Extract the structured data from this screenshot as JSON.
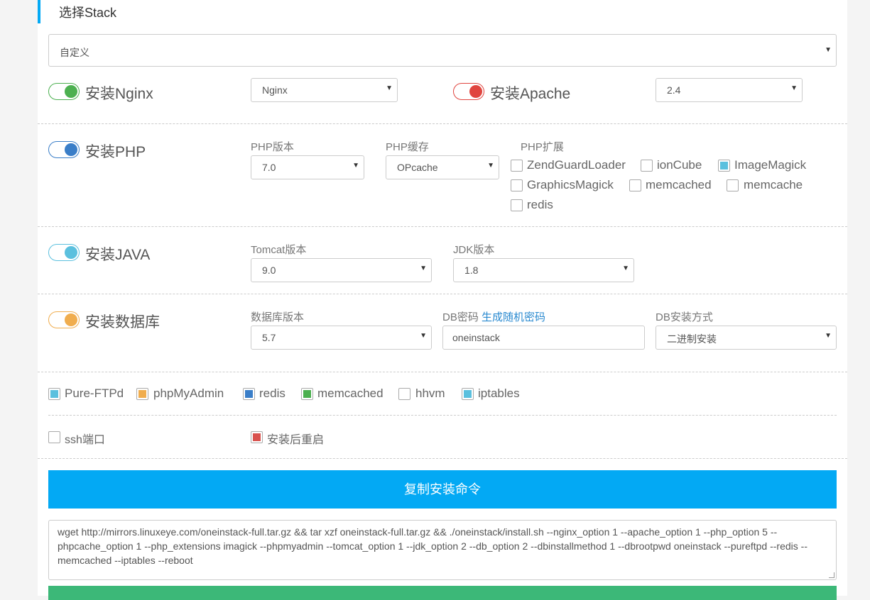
{
  "header": {
    "title": "选择Stack"
  },
  "stack_select": {
    "value": "自定义"
  },
  "nginx": {
    "label": "安装Nginx",
    "version": "Nginx",
    "color": "#4cb050"
  },
  "apache": {
    "label": "安装Apache",
    "version": "2.4",
    "color": "#e0453f"
  },
  "php": {
    "label": "安装PHP",
    "color": "#3a7ec8",
    "version_label": "PHP版本",
    "version": "7.0",
    "cache_label": "PHP缓存",
    "cache": "OPcache",
    "ext_label": "PHP扩展",
    "extensions": [
      {
        "name": "ZendGuardLoader",
        "checked": false
      },
      {
        "name": "ionCube",
        "checked": false
      },
      {
        "name": "ImageMagick",
        "checked": true
      },
      {
        "name": "GraphicsMagick",
        "checked": false
      },
      {
        "name": "memcached",
        "checked": false
      },
      {
        "name": "memcache",
        "checked": false
      },
      {
        "name": "redis",
        "checked": false
      }
    ]
  },
  "java": {
    "label": "安装JAVA",
    "color": "#5bc0de",
    "tomcat_label": "Tomcat版本",
    "tomcat": "9.0",
    "jdk_label": "JDK版本",
    "jdk": "1.8"
  },
  "db": {
    "label": "安装数据库",
    "color": "#f0ad4e",
    "version_label": "数据库版本",
    "version": "5.7",
    "password_label": "DB密码",
    "password_link": "生成随机密码",
    "password": "oneinstack",
    "method_label": "DB安装方式",
    "method": "二进制安装"
  },
  "extras": [
    {
      "name": "Pure-FTPd",
      "checked": true,
      "color": "#5bc0de"
    },
    {
      "name": "phpMyAdmin",
      "checked": true,
      "color": "#f0ad4e"
    },
    {
      "name": "redis",
      "checked": true,
      "color": "#3a7ec8"
    },
    {
      "name": "memcached",
      "checked": true,
      "color": "#4cb050"
    },
    {
      "name": "hhvm",
      "checked": false,
      "color": "#ffffff"
    },
    {
      "name": "iptables",
      "checked": true,
      "color": "#5bc0de"
    }
  ],
  "options": {
    "ssh_port": {
      "label": "ssh端口",
      "checked": false
    },
    "reboot": {
      "label": "安装后重启",
      "checked": true,
      "color": "#d9534f"
    }
  },
  "copy_button": {
    "label": "复制安装命令"
  },
  "command": "wget http://mirrors.linuxeye.com/oneinstack-full.tar.gz && tar xzf oneinstack-full.tar.gz && ./oneinstack/install.sh --nginx_option 1 --apache_option 1 --php_option 5 --phpcache_option 1 --php_extensions imagick --phpmyadmin  --tomcat_option 1 --jdk_option 2 --db_option 2 --dbinstallmethod 1 --dbrootpwd oneinstack --pureftpd  --redis  --memcached  --iptables  --reboot"
}
